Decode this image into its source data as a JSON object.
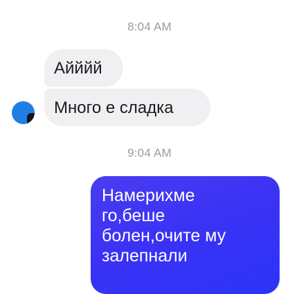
{
  "conversation": {
    "timestamps": [
      "8:04 AM",
      "9:04 AM"
    ],
    "incoming": [
      {
        "text": "Айййй"
      },
      {
        "text": "Много е сладка"
      }
    ],
    "outgoing": [
      {
        "lines": [
          "Намерихме",
          "го,беше",
          "болен,очите му",
          "залепнали"
        ]
      }
    ]
  },
  "colors": {
    "incoming_bubble": "#f0f0f2",
    "outgoing_bubble": "#3b32f5",
    "avatar": "#1f7fe3",
    "timestamp_text": "#9b9ba1"
  }
}
